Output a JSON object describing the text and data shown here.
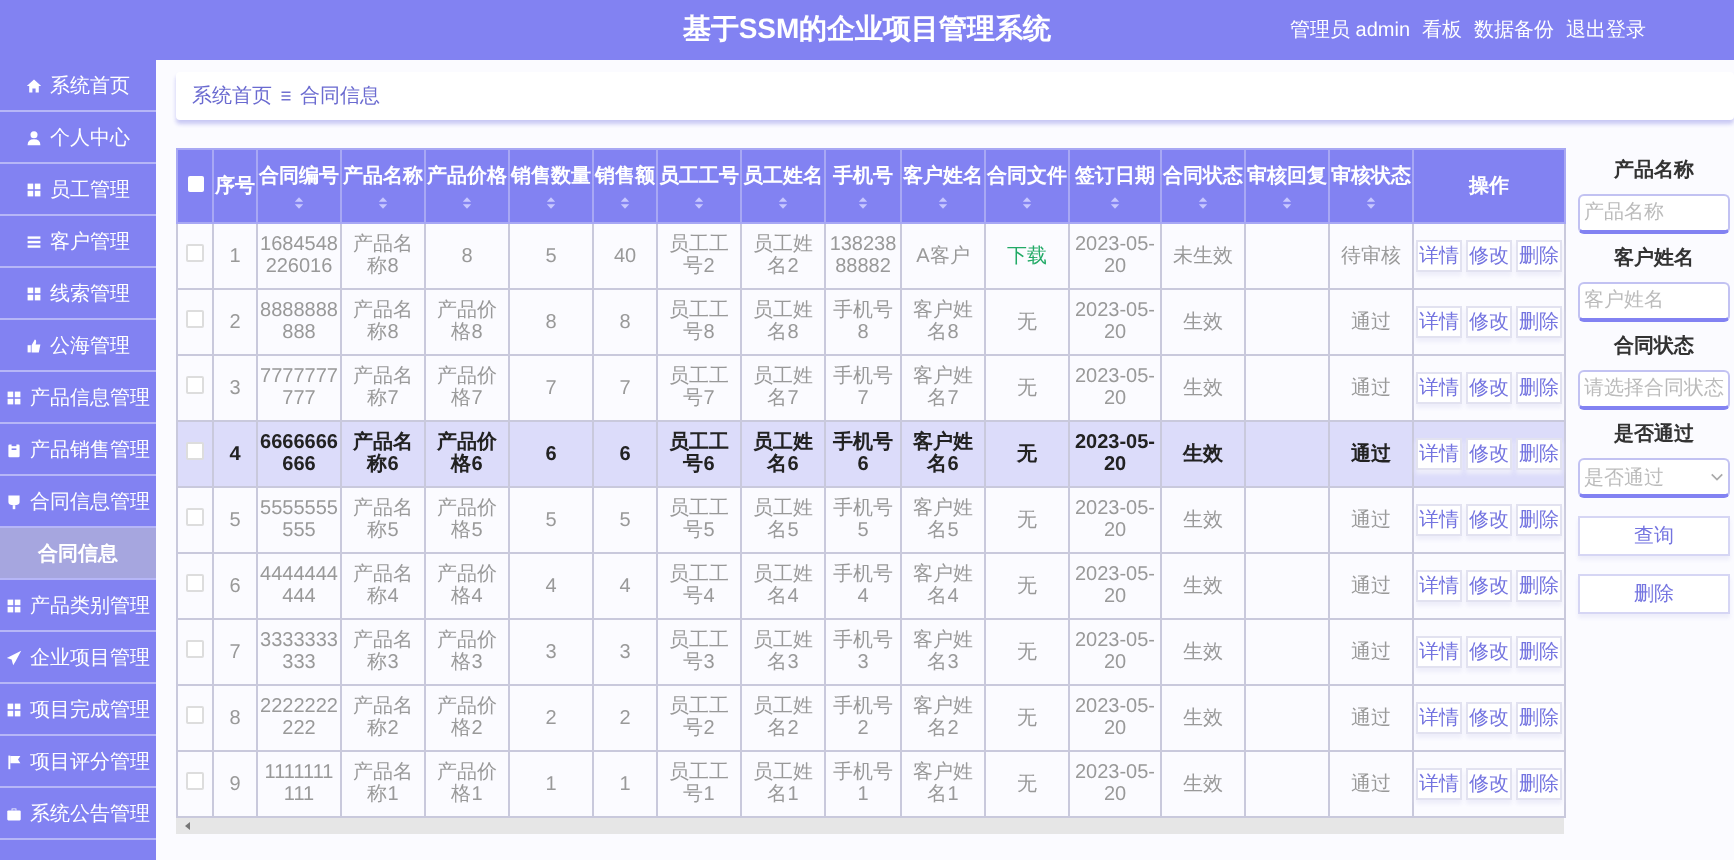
{
  "header": {
    "title": "基于SSM的企业项目管理系统",
    "links": [
      "管理员 admin",
      "看板",
      "数据备份",
      "退出登录"
    ]
  },
  "sidebar": {
    "items": [
      {
        "label": "系统首页",
        "selected": false
      },
      {
        "label": "个人中心",
        "selected": false
      },
      {
        "label": "员工管理",
        "selected": false
      },
      {
        "label": "客户管理",
        "selected": false
      },
      {
        "label": "线索管理",
        "selected": false
      },
      {
        "label": "公海管理",
        "selected": false
      },
      {
        "label": "产品信息管理",
        "selected": false
      },
      {
        "label": "产品销售管理",
        "selected": false
      },
      {
        "label": "合同信息管理",
        "selected": false,
        "expanded": true,
        "children": [
          {
            "label": "合同信息",
            "selected": true
          }
        ]
      },
      {
        "label": "产品类别管理",
        "selected": false
      },
      {
        "label": "企业项目管理",
        "selected": false
      },
      {
        "label": "项目完成管理",
        "selected": false
      },
      {
        "label": "项目评分管理",
        "selected": false
      },
      {
        "label": "系统公告管理",
        "selected": false
      }
    ]
  },
  "breadcrumb": [
    "系统首页",
    "合同信息"
  ],
  "table": {
    "select_all_checked": false,
    "columns": [
      {
        "label": "序号",
        "sortable": false
      },
      {
        "label": "合同编号",
        "sortable": true
      },
      {
        "label": "产品名称",
        "sortable": true
      },
      {
        "label": "产品价格",
        "sortable": true
      },
      {
        "label": "销售数量",
        "sortable": true
      },
      {
        "label": "销售额",
        "sortable": true
      },
      {
        "label": "员工工号",
        "sortable": true
      },
      {
        "label": "员工姓名",
        "sortable": true
      },
      {
        "label": "手机号",
        "sortable": true
      },
      {
        "label": "客户姓名",
        "sortable": true
      },
      {
        "label": "合同文件",
        "sortable": true
      },
      {
        "label": "签订日期",
        "sortable": true
      },
      {
        "label": "合同状态",
        "sortable": true
      },
      {
        "label": "审核回复",
        "sortable": true
      },
      {
        "label": "审核状态",
        "sortable": true
      },
      {
        "label": "操作",
        "sortable": false
      }
    ],
    "rows": [
      {
        "selected": false,
        "file_link": true,
        "cells": [
          "1",
          "1684548226016",
          "产品名称8",
          "8",
          "5",
          "40",
          "员工工号2",
          "员工姓名2",
          "13823888882",
          "A客户",
          "下载",
          "2023-05-20",
          "未生效",
          null,
          "待审核"
        ],
        "actions": [
          "详情",
          "修改",
          "删除"
        ]
      },
      {
        "selected": false,
        "file_link": false,
        "cells": [
          "2",
          "8888888888",
          "产品名称8",
          "产品价格8",
          "8",
          "8",
          "员工工号8",
          "员工姓名8",
          "手机号8",
          "客户姓名8",
          "无",
          "2023-05-20",
          "生效",
          null,
          "通过"
        ],
        "actions": [
          "详情",
          "修改",
          "删除"
        ]
      },
      {
        "selected": false,
        "file_link": false,
        "cells": [
          "3",
          "7777777777",
          "产品名称7",
          "产品价格7",
          "7",
          "7",
          "员工工号7",
          "员工姓名7",
          "手机号7",
          "客户姓名7",
          "无",
          "2023-05-20",
          "生效",
          null,
          "通过"
        ],
        "actions": [
          "详情",
          "修改",
          "删除"
        ]
      },
      {
        "selected": true,
        "file_link": false,
        "cells": [
          "4",
          "6666666666",
          "产品名称6",
          "产品价格6",
          "6",
          "6",
          "员工工号6",
          "员工姓名6",
          "手机号6",
          "客户姓名6",
          "无",
          "2023-05-20",
          "生效",
          null,
          "通过"
        ],
        "actions": [
          "详情",
          "修改",
          "删除"
        ]
      },
      {
        "selected": false,
        "file_link": false,
        "cells": [
          "5",
          "5555555555",
          "产品名称5",
          "产品价格5",
          "5",
          "5",
          "员工工号5",
          "员工姓名5",
          "手机号5",
          "客户姓名5",
          "无",
          "2023-05-20",
          "生效",
          null,
          "通过"
        ],
        "actions": [
          "详情",
          "修改",
          "删除"
        ]
      },
      {
        "selected": false,
        "file_link": false,
        "cells": [
          "6",
          "4444444444",
          "产品名称4",
          "产品价格4",
          "4",
          "4",
          "员工工号4",
          "员工姓名4",
          "手机号4",
          "客户姓名4",
          "无",
          "2023-05-20",
          "生效",
          null,
          "通过"
        ],
        "actions": [
          "详情",
          "修改",
          "删除"
        ]
      },
      {
        "selected": false,
        "file_link": false,
        "cells": [
          "7",
          "3333333333",
          "产品名称3",
          "产品价格3",
          "3",
          "3",
          "员工工号3",
          "员工姓名3",
          "手机号3",
          "客户姓名3",
          "无",
          "2023-05-20",
          "生效",
          null,
          "通过"
        ],
        "actions": [
          "详情",
          "修改",
          "删除"
        ]
      },
      {
        "selected": false,
        "file_link": false,
        "cells": [
          "8",
          "2222222222",
          "产品名称2",
          "产品价格2",
          "2",
          "2",
          "员工工号2",
          "员工姓名2",
          "手机号2",
          "客户姓名2",
          "无",
          "2023-05-20",
          "生效",
          null,
          "通过"
        ],
        "actions": [
          "详情",
          "修改",
          "删除"
        ]
      },
      {
        "selected": false,
        "file_link": false,
        "cells": [
          "9",
          "1111111111",
          "产品名称1",
          "产品价格1",
          "1",
          "1",
          "员工工号1",
          "员工姓名1",
          "手机号1",
          "客户姓名1",
          "无",
          "2023-05-20",
          "生效",
          null,
          "通过"
        ],
        "actions": [
          "详情",
          "修改",
          "删除"
        ]
      }
    ]
  },
  "filters": {
    "fields": [
      {
        "label": "产品名称",
        "placeholder": "产品名称",
        "kind": "input"
      },
      {
        "label": "客户姓名",
        "placeholder": "客户姓名",
        "kind": "input"
      },
      {
        "label": "合同状态",
        "placeholder": "请选择合同状态",
        "kind": "input"
      },
      {
        "label": "是否通过",
        "placeholder": "是否通过",
        "kind": "select"
      }
    ],
    "buttons": [
      "查询",
      "删除"
    ]
  }
}
